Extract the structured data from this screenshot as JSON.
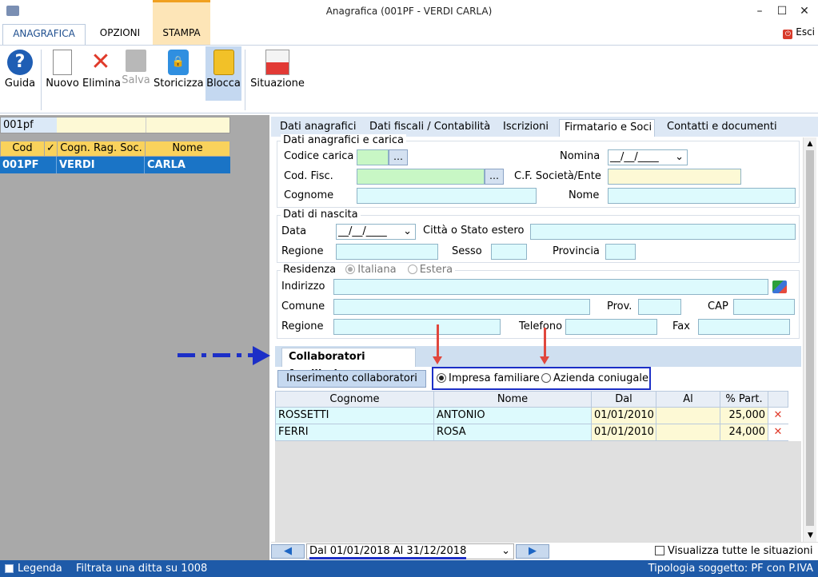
{
  "window": {
    "title": "Anagrafica (001PF - VERDI CARLA)",
    "minimize": "–",
    "maximize": "☐",
    "close": "✕"
  },
  "menu_tabs": [
    "ANAGRAFICA",
    "OPZIONI",
    "STAMPA"
  ],
  "esci": "Esci",
  "ribbon": {
    "guida": "Guida",
    "nuovo": "Nuovo",
    "elimina": "Elimina",
    "salva": "Salva",
    "storicizza": "Storicizza",
    "blocca": "Blocca",
    "situazione": "Situazione"
  },
  "search": {
    "value": "001pf"
  },
  "left_grid": {
    "headers": [
      "Cod",
      "✓",
      "Cogn. Rag. Soc.",
      "Nome"
    ],
    "row": [
      "001PF",
      "",
      "VERDI",
      "CARLA"
    ]
  },
  "tabs": [
    "Dati anagrafici",
    "Dati fiscali / Contabilità",
    "Iscrizioni",
    "Firmatario e Soci",
    "Contatti e documenti"
  ],
  "group1": {
    "title": "Dati anagrafici e carica",
    "codice_carica": "Codice carica",
    "nomina": "Nomina",
    "cod_fisc": "Cod. Fisc.",
    "cf_societa": "C.F. Società/Ente",
    "cognome": "Cognome",
    "nome": "Nome",
    "date_placeholder": "__/__/____"
  },
  "group2": {
    "title": "Dati di nascita",
    "data": "Data",
    "citta": "Città o Stato estero",
    "regione": "Regione",
    "sesso": "Sesso",
    "provincia": "Provincia"
  },
  "group3": {
    "title": "Residenza",
    "italiana": "Italiana",
    "estera": "Estera",
    "indirizzo": "Indirizzo",
    "comune": "Comune",
    "prov": "Prov.",
    "cap": "CAP",
    "regione": "Regione",
    "telefono": "Telefono",
    "fax": "Fax"
  },
  "collab": {
    "tab": "Collaboratori familiari",
    "btn": "Inserimento collaboratori",
    "opt1": "Impresa familiare",
    "opt2": "Azienda coniugale"
  },
  "grid": {
    "headers": [
      "Cognome",
      "Nome",
      "Dal",
      "Al",
      "% Part."
    ],
    "rows": [
      [
        "ROSSETTI",
        "ANTONIO",
        "01/01/2010",
        "",
        "25,000"
      ],
      [
        "FERRI",
        "ROSA",
        "01/01/2010",
        "",
        "24,000"
      ]
    ]
  },
  "bottom": {
    "period": "Dal 01/01/2018 Al 31/12/2018",
    "show_all": "Visualizza tutte le situazioni"
  },
  "status": {
    "legenda": "Legenda",
    "filtro": "Filtrata una ditta su 1008",
    "tipologia": "Tipologia soggetto: PF con P.IVA"
  },
  "colors": {
    "accent": "#1e5aa8",
    "highlight_border": "#1c2fc7",
    "arrow_red": "#e0473d",
    "arrow_blue": "#1c2fc7"
  }
}
